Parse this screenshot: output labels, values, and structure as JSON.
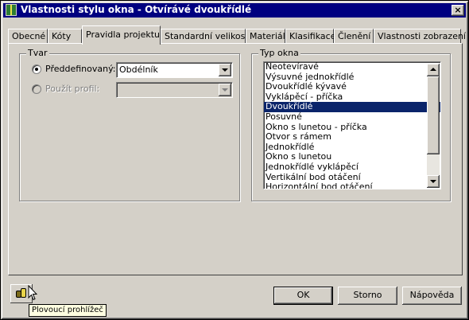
{
  "window": {
    "title": "Vlastnosti stylu okna - Otvírávé dvoukřídlé",
    "close_label": "×"
  },
  "tabs": [
    {
      "label": "Obecné",
      "active": false
    },
    {
      "label": "Kóty",
      "active": false
    },
    {
      "label": "Pravidla projektu",
      "active": true
    },
    {
      "label": "Standardní velikosti",
      "active": false
    },
    {
      "label": "Materiály",
      "active": false
    },
    {
      "label": "Klasifikace",
      "active": false
    },
    {
      "label": "Členění",
      "active": false
    },
    {
      "label": "Vlastnosti zobrazení",
      "active": false
    }
  ],
  "tvar": {
    "group_label": "Tvar",
    "predefined_label": "Předdefinovaný:",
    "predefined_checked": true,
    "predefined_value": "Obdélník",
    "profile_label": "Použít profil:",
    "profile_enabled": false,
    "profile_value": ""
  },
  "typ_okna": {
    "group_label": "Typ okna",
    "items": [
      "Neotevíravé",
      "Výsuvné jednokřídlé",
      "Dvoukřídlé kývavé",
      "Vyklápěcí - příčka",
      "Dvoukřídlé",
      "Posuvné",
      "Okno s lunetou - příčka",
      "Otvor s rámem",
      "Jednokřídlé",
      "Okno s lunetou",
      "Jednokřídlé vyklápěcí",
      "Vertikální bod otáčení",
      "Horizontální bod otáčení"
    ],
    "selected": "Dvoukřídlé",
    "selected_index": 4
  },
  "buttons": {
    "ok": "OK",
    "cancel": "Storno",
    "help": "Nápověda"
  },
  "floating_viewer": {
    "icon": "binoculars-icon",
    "tooltip": "Plovoucí prohlížeč"
  },
  "colors": {
    "titlebar": "#000080",
    "selection": "#0a246a",
    "face": "#d4d0c8",
    "tooltip_bg": "#ffffe1"
  }
}
